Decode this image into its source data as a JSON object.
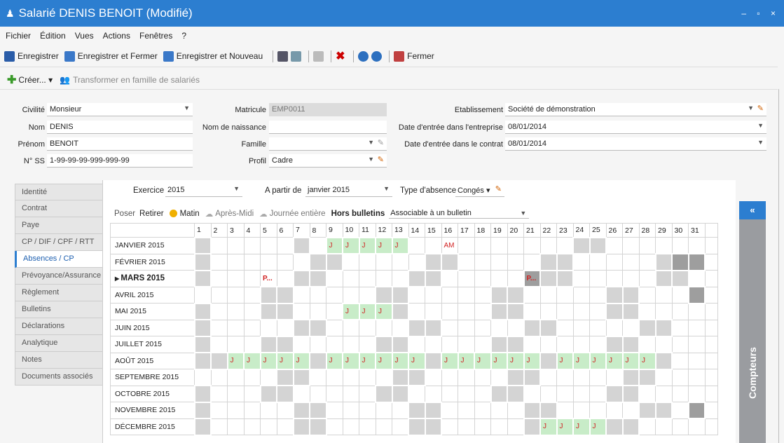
{
  "window": {
    "title": "Salarié DENIS BENOIT (Modifié)",
    "controls": "– ▫ ×"
  },
  "menu": [
    "Fichier",
    "Édition",
    "Vues",
    "Actions",
    "Fenêtres",
    "?"
  ],
  "toolbar": {
    "save": "Enregistrer",
    "save_close": "Enregistrer et Fermer",
    "save_new": "Enregistrer et Nouveau",
    "close": "Fermer"
  },
  "toolbar2": {
    "create": "Créer... ▾",
    "transform": "Transformer en famille de salariés"
  },
  "form": {
    "civilite": {
      "label": "Civilité",
      "value": "Monsieur"
    },
    "nom": {
      "label": "Nom",
      "value": "DENIS"
    },
    "prenom": {
      "label": "Prénom",
      "value": "BENOIT"
    },
    "nss": {
      "label": "N° SS",
      "value": "1-99-99-99-999-999-99"
    },
    "matricule": {
      "label": "Matricule",
      "value": "EMP0011"
    },
    "nom_naissance": {
      "label": "Nom de naissance",
      "value": ""
    },
    "famille": {
      "label": "Famille",
      "value": ""
    },
    "profil": {
      "label": "Profil",
      "value": "Cadre"
    },
    "etablissement": {
      "label": "Etablissement",
      "value": "Société de démonstration"
    },
    "date_entree_entreprise": {
      "label": "Date d'entrée dans l'entreprise",
      "value": "08/01/2014"
    },
    "date_entree_contrat": {
      "label": "Date d'entrée dans le contrat",
      "value": "08/01/2014"
    }
  },
  "tabs": [
    "Identité",
    "Contrat",
    "Paye",
    "CP / DIF / CPF / RTT",
    "Absences / CP",
    "Prévoyance/Assurance",
    "Règlement",
    "Bulletins",
    "Déclarations",
    "Analytique",
    "Notes",
    "Documents associés"
  ],
  "active_tab": "Absences / CP",
  "filters": {
    "exercice_label": "Exercice",
    "exercice": "2015",
    "from_label": "A partir de",
    "from": "janvier 2015",
    "type_label": "Type d'absence",
    "type": "Congés ▾"
  },
  "actions": {
    "poser": "Poser",
    "retirer": "Retirer",
    "matin": "Matin",
    "apres_midi": "Après-Midi",
    "journee": "Journée entière",
    "hors": "Hors bulletins",
    "assoc": "Associable à un bulletin"
  },
  "calendar": {
    "days": [
      "1",
      "2",
      "3",
      "4",
      "5",
      "6",
      "7",
      "8",
      "9",
      "10",
      "11",
      "12",
      "13",
      "14",
      "15",
      "16",
      "17",
      "18",
      "19",
      "20",
      "21",
      "22",
      "23",
      "24",
      "25",
      "26",
      "27",
      "28",
      "29",
      "30",
      "31"
    ],
    "months": [
      "JANVIER 2015",
      "FÉVRIER 2015",
      "MARS 2015",
      "AVRIL 2015",
      "MAI 2015",
      "JUIN 2015",
      "JUILLET 2015",
      "AOÛT 2015",
      "SEPTEMBRE 2015",
      "OCTOBRE 2015",
      "NOVEMBRE 2015",
      "DÉCEMBRE 2015"
    ],
    "current_month": "MARS 2015",
    "cells": [
      "g.....g.JJJJJ..AM.......gg......gg...g",
      "g......gg.....gg.....gg.....gddd",
      "g...P.gg.....gg.....Pgg.....gg..",
      "....gg.....gg.....gg.....gg...d",
      "g...gg...JJJg.....gg.....gg.....g",
      "g.....gg.....gg.....gg.....gg..d",
      "g...gg.....gg.....gg.....gg.....",
      "ggJJJJJgJJJJJJgJJJJJJgJJJJJJg..",
      ".....gg.....gg.....gg.....gg...d",
      "g...gg.....gg.....gg.....gg.....",
      "g.....gg.....gg.....gg.....gg.d",
      "g.....gg.....gg.....gJJJJgg....."
    ]
  },
  "right_panel": {
    "toggle": "«",
    "title": "Compteurs"
  }
}
